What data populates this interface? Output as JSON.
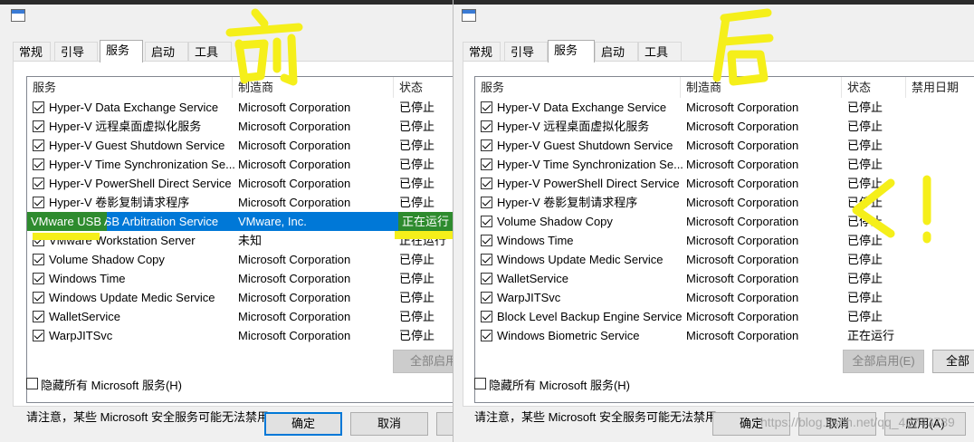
{
  "left_dialog": {
    "tabs": [
      "常规",
      "引导",
      "服务",
      "启动",
      "工具"
    ],
    "active_tab": "服务",
    "columns": [
      "服务",
      "制造商",
      "状态"
    ],
    "rows": [
      {
        "service": "Hyper-V Data Exchange Service",
        "maker": "Microsoft Corporation",
        "status": "已停止"
      },
      {
        "service": "Hyper-V 远程桌面虚拟化服务",
        "maker": "Microsoft Corporation",
        "status": "已停止"
      },
      {
        "service": "Hyper-V Guest Shutdown Service",
        "maker": "Microsoft Corporation",
        "status": "已停止"
      },
      {
        "service": "Hyper-V Time Synchronization Se...",
        "maker": "Microsoft Corporation",
        "status": "已停止"
      },
      {
        "service": "Hyper-V PowerShell Direct Service",
        "maker": "Microsoft Corporation",
        "status": "已停止"
      },
      {
        "service": "Hyper-V 卷影复制请求程序",
        "maker": "Microsoft Corporation",
        "status": "已停止"
      },
      {
        "service": "VMware USB Arbitration Service",
        "maker": "VMware, Inc.",
        "status": "正在运行"
      },
      {
        "service": "VMware Workstation Server",
        "maker": "未知",
        "status": "正在运行"
      },
      {
        "service": "Volume Shadow Copy",
        "maker": "Microsoft Corporation",
        "status": "已停止"
      },
      {
        "service": "Windows Time",
        "maker": "Microsoft Corporation",
        "status": "已停止"
      },
      {
        "service": "Windows Update Medic Service",
        "maker": "Microsoft Corporation",
        "status": "已停止"
      },
      {
        "service": "WalletService",
        "maker": "Microsoft Corporation",
        "status": "已停止"
      },
      {
        "service": "WarpJITSvc",
        "maker": "Microsoft Corporation",
        "status": "已停止"
      }
    ],
    "note": "请注意，某些 Microsoft 安全服务可能无法禁用。",
    "enable_all": "全部启用",
    "hide_ms": "隐藏所有 Microsoft 服务(H)",
    "ok": "确定",
    "cancel": "取消"
  },
  "right_dialog": {
    "tabs": [
      "常规",
      "引导",
      "服务",
      "启动",
      "工具"
    ],
    "active_tab": "服务",
    "columns": [
      "服务",
      "制造商",
      "状态",
      "禁用日期"
    ],
    "rows": [
      {
        "service": "Hyper-V Data Exchange Service",
        "maker": "Microsoft Corporation",
        "status": "已停止"
      },
      {
        "service": "Hyper-V 远程桌面虚拟化服务",
        "maker": "Microsoft Corporation",
        "status": "已停止"
      },
      {
        "service": "Hyper-V Guest Shutdown Service",
        "maker": "Microsoft Corporation",
        "status": "已停止"
      },
      {
        "service": "Hyper-V Time Synchronization Se...",
        "maker": "Microsoft Corporation",
        "status": "已停止"
      },
      {
        "service": "Hyper-V PowerShell Direct Service",
        "maker": "Microsoft Corporation",
        "status": "已停止"
      },
      {
        "service": "Hyper-V 卷影复制请求程序",
        "maker": "Microsoft Corporation",
        "status": "已停止"
      },
      {
        "service": "Volume Shadow Copy",
        "maker": "Microsoft Corporation",
        "status": "已停止"
      },
      {
        "service": "Windows Time",
        "maker": "Microsoft Corporation",
        "status": "已停止"
      },
      {
        "service": "Windows Update Medic Service",
        "maker": "Microsoft Corporation",
        "status": "已停止"
      },
      {
        "service": "WalletService",
        "maker": "Microsoft Corporation",
        "status": "已停止"
      },
      {
        "service": "WarpJITSvc",
        "maker": "Microsoft Corporation",
        "status": "已停止"
      },
      {
        "service": "Block Level Backup Engine Service",
        "maker": "Microsoft Corporation",
        "status": "已停止"
      },
      {
        "service": "Windows Biometric Service",
        "maker": "Microsoft Corporation",
        "status": "正在运行"
      }
    ],
    "note": "请注意，某些 Microsoft 安全服务可能无法禁用。",
    "enable_all": "全部启用(E)",
    "disable_all": "全部",
    "hide_ms": "隐藏所有 Microsoft 服务(H)",
    "ok": "确定",
    "cancel": "取消",
    "apply": "应用(A)"
  },
  "annotations": {
    "before": "前",
    "after": "后",
    "exclaim": "<!"
  },
  "watermark": "https://blog.csdn.net/qq_40743789",
  "colors": {
    "selection": "#0078d7",
    "highlighter_yellow": "#f5ef1a",
    "highlighter_green": "#2e8b2e"
  }
}
